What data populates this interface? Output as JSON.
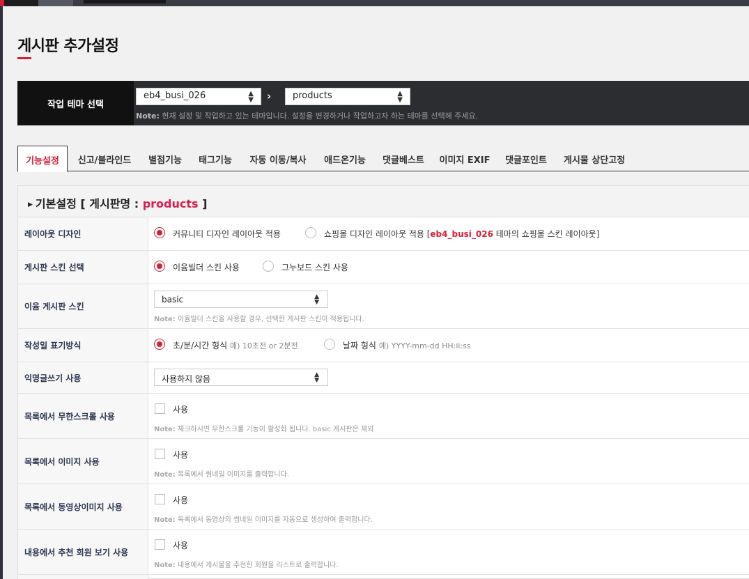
{
  "page": {
    "title": "게시판 추가설정"
  },
  "theme_bar": {
    "label": "작업 테마 선택",
    "theme_value": "eb4_busi_026",
    "board_value": "products",
    "arrow": "›",
    "note_prefix": "Note:",
    "note": "현재 설정 및 작업하고 있는 테마입니다. 설정을 변경하거나 작업하고자 하는 테마를 선택해 주세요."
  },
  "tabs": [
    {
      "label": "기능설정",
      "active": true
    },
    {
      "label": "신고/블라인드"
    },
    {
      "label": "별점기능"
    },
    {
      "label": "태그기능"
    },
    {
      "label": "자동 이동/복사"
    },
    {
      "label": "애드온기능"
    },
    {
      "label": "댓글베스트"
    },
    {
      "label": "이미지 EXIF"
    },
    {
      "label": "댓글포인트"
    },
    {
      "label": "게시물 상단고정"
    }
  ],
  "section": {
    "caret": "▶",
    "title_prefix": "기본설정 [ 게시판명 : ",
    "board_name": "products",
    "title_suffix": " ]"
  },
  "rows": {
    "layout": {
      "label": "레이아웃 디자인",
      "opt1": "커뮤니티 디자인 레이아웃 적용",
      "opt2_prefix": "쇼핑몰 디자인 레이아웃 적용 [",
      "opt2_theme": "eb4_busi_026",
      "opt2_suffix": " 테마의 쇼핑몰 스킨 레이아웃]"
    },
    "skin_select": {
      "label": "게시판 스킨 선택",
      "opt1": "이윰빌더 스킨 사용",
      "opt2": "그누보드 스킨 사용"
    },
    "eyoom_skin": {
      "label": "이윰 게시판 스킨",
      "value": "basic",
      "note_prefix": "Note:",
      "note": "이윰빌더 스킨을 사용할 경우, 선택한 게시판 스킨이 적용됩니다."
    },
    "date_format": {
      "label": "작성일 표기방식",
      "opt1": "초/분/시간 형식",
      "opt1_ex": "예) 10초전 or 2분전",
      "opt2": "날짜 형식",
      "opt2_ex": "예) YYYY-mm-dd HH:ii:ss"
    },
    "anonymous": {
      "label": "익명글쓰기 사용",
      "value": "사용하지 않음"
    },
    "infinite_scroll": {
      "label": "목록에서 무한스크롤 사용",
      "check_label": "사용",
      "note_prefix": "Note:",
      "note": "체크하시면 무한스크롤 기능이 활성화 됩니다. basic 게시판은 제외"
    },
    "list_image": {
      "label": "목록에서 이미지 사용",
      "check_label": "사용",
      "note_prefix": "Note:",
      "note": "목록에서 썸네일 이미지를 출력합니다."
    },
    "list_video": {
      "label": "목록에서 동영상이미지 사용",
      "check_label": "사용",
      "note_prefix": "Note:",
      "note": "목록에서 동영상의 썸네일 이미지를 자동으로 생성하여 출력합니다."
    },
    "recommend": {
      "label": "내용에서 추천 회원 보기 사용",
      "check_label": "사용",
      "note_prefix": "Note:",
      "note": "내용에서 게시물을 추천한 회원을 리스트로 출력합니다."
    }
  },
  "colors": {
    "accent": "#d6203a",
    "dark_bar": "#2b2d31",
    "label_bg": "#111111"
  }
}
